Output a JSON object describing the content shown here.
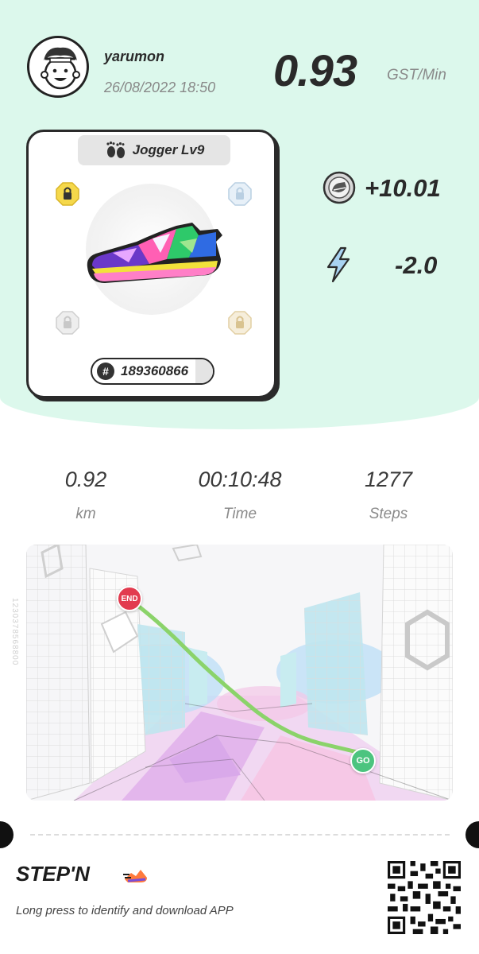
{
  "user": {
    "name": "yarumon",
    "datetime": "26/08/2022 18:50"
  },
  "earning": {
    "rate": "0.93",
    "unit": "GST/Min"
  },
  "sneaker": {
    "type_label": "Jogger Lv9",
    "id": "189360866",
    "colors": [
      "#6a38c9",
      "#ff5fb4",
      "#2ec96a",
      "#2f6be3",
      "#f2e23a"
    ]
  },
  "rewards": {
    "gst": "+10.01",
    "energy": "-2.0"
  },
  "stats": [
    {
      "value": "0.92",
      "label": "km"
    },
    {
      "value": "00:10:48",
      "label": "Time"
    },
    {
      "value": "1277",
      "label": "Steps"
    }
  ],
  "map": {
    "start_label": "GO",
    "end_label": "END",
    "side_code": "1230378568800",
    "route_color": "#8bd36a"
  },
  "footer": {
    "brand": "STEP'N",
    "tagline": "Long press to identify and download APP"
  },
  "icons": {
    "avatar": "avatar-icon",
    "footprints": "footprints-icon",
    "gem_slot": "locked-gem-slot-icon",
    "gst": "gst-token-icon",
    "energy": "lightning-icon",
    "qr": "qr-code-icon"
  }
}
